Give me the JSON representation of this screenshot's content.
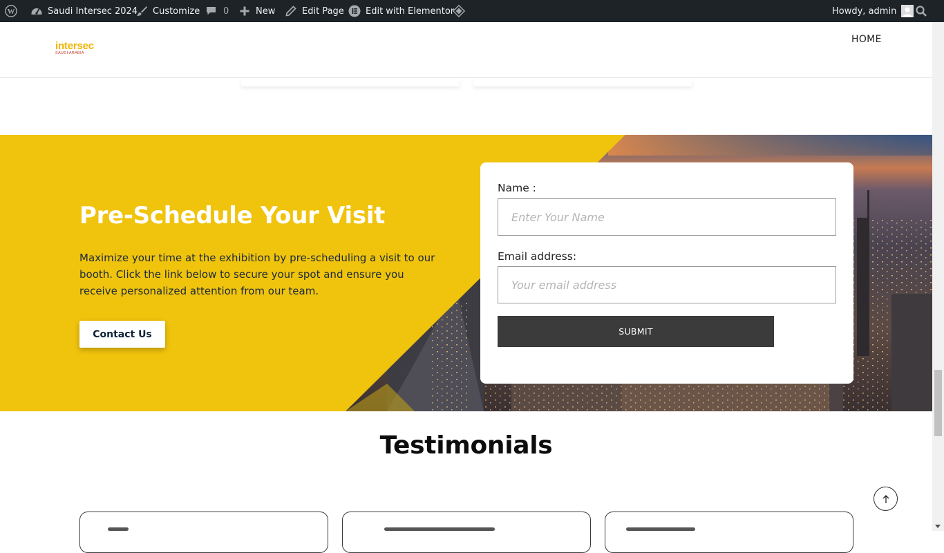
{
  "admin_bar": {
    "site_name": "Saudi Intersec 2024",
    "customize": "Customize",
    "comments_count": "0",
    "new": "New",
    "edit_page": "Edit Page",
    "edit_elementor": "Edit with Elementor",
    "howdy": "Howdy, admin",
    "icons": [
      "wordpress-icon",
      "dashboard-icon",
      "brush-icon",
      "comment-icon",
      "plus-icon",
      "pencil-icon",
      "elementor-icon",
      "diamond-icon",
      "avatar-icon",
      "search-icon"
    ]
  },
  "header": {
    "logo_main": "intersec",
    "logo_sub": "SAUDI ARABIA",
    "nav": [
      {
        "label": "HOME"
      }
    ]
  },
  "schedule": {
    "title": "Pre-Schedule Your Visit",
    "description": "Maximize your time at the exhibition by pre-scheduling a visit to our booth. Click the link below to secure your spot and ensure you receive personalized attention from our team.",
    "contact_button": "Contact Us",
    "accent_color": "#f0c30d"
  },
  "form": {
    "name_label": "Name :",
    "name_placeholder": "Enter Your Name",
    "name_value": "",
    "email_label": "Email address:",
    "email_placeholder": "Your email address",
    "email_value": "",
    "submit_label": "SUBMIT"
  },
  "testimonials": {
    "title": "Testimonials"
  }
}
